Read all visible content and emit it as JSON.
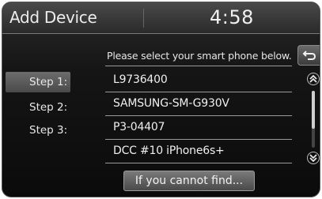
{
  "header": {
    "title": "Add Device",
    "clock": "4:58"
  },
  "instruction": "Please select your smart phone below.",
  "steps": [
    {
      "label": "Step 1:",
      "active": true
    },
    {
      "label": "Step 2:",
      "active": false
    },
    {
      "label": "Step 3:",
      "active": false
    }
  ],
  "devices": [
    "L9736400",
    "SAMSUNG-SM-G930V",
    "P3-04407",
    "DCC #10 iPhone6s+"
  ],
  "find_button_label": "If you cannot find...",
  "icons": {
    "back": "back-arrow-icon",
    "scroll_up": "double-chevron-up-icon",
    "scroll_down": "double-chevron-down-icon"
  }
}
